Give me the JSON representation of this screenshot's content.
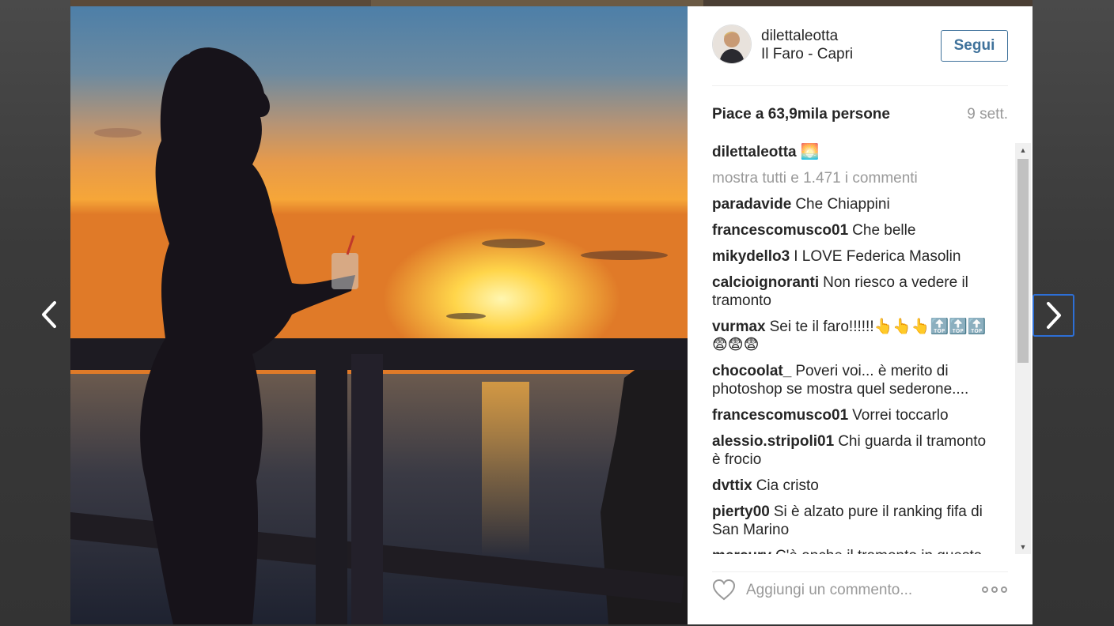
{
  "post": {
    "username": "dilettaleotta",
    "location": "Il Faro - Capri",
    "follow_label": "Segui",
    "likes": "Piace a 63,9mila persone",
    "time": "9 sett.",
    "caption_user": "dilettaleotta",
    "caption_text": "🌅",
    "show_all_comments": "mostra tutti e 1.471 i commenti",
    "add_comment_placeholder": "Aggiungi un commento..."
  },
  "comments": [
    {
      "user": "paradavide",
      "text": "Che Chiappini"
    },
    {
      "user": "francescomusco01",
      "text": "Che belle"
    },
    {
      "user": "mikydello3",
      "text": "I LOVE Federica Masolin"
    },
    {
      "user": "calcioignoranti",
      "text": "Non riesco a vedere il tramonto"
    },
    {
      "user": "vurmax",
      "text": "Sei te il faro!!!!!!👆👆👆🔝🔝🔝😨😨😨"
    },
    {
      "user": "chocoolat_",
      "text": "Poveri voi... è merito di photoshop se mostra quel sederone...."
    },
    {
      "user": "francescomusco01",
      "text": "Vorrei toccarlo"
    },
    {
      "user": "alessio.stripoli01",
      "text": "Chi guarda il tramonto è frocio"
    },
    {
      "user": "dvttix",
      "text": "Cia cristo"
    },
    {
      "user": "pierty00",
      "text": "Si è alzato pure il ranking fifa di San Marino"
    },
    {
      "user": "mercurv",
      "text": "C'è anche il tramonto in questa"
    }
  ],
  "colors": {
    "accent": "#3f729b",
    "nav_focus": "#2d6fd6",
    "muted": "#999999",
    "text": "#262626"
  },
  "icons": {
    "prev": "chevron-left-icon",
    "next": "chevron-right-icon",
    "like": "heart-icon",
    "more": "more-options-icon"
  }
}
